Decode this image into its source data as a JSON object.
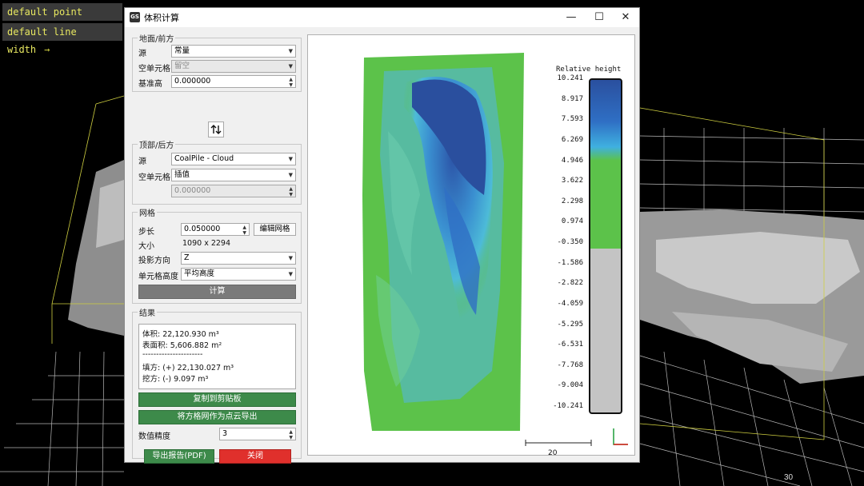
{
  "viewer": {
    "overlay_labels": [
      "default point size",
      "default line width"
    ],
    "scale_text": "30"
  },
  "window": {
    "title": "体积计算",
    "icon_text": "GS"
  },
  "ground": {
    "group_title": "地面/前方",
    "source_label": "源",
    "source_value": "常量",
    "empty_cell_label": "空单元格",
    "empty_cell_value": "留空",
    "base_height_label": "基准高",
    "base_height_value": "0.000000"
  },
  "top": {
    "group_title": "顶部/后方",
    "source_label": "源",
    "source_value": "CoalPile - Cloud",
    "empty_cell_label": "空单元格",
    "empty_cell_value": "插值",
    "value": "0.000000"
  },
  "grid": {
    "group_title": "网格",
    "step_label": "步长",
    "step_value": "0.050000",
    "edit_grid_label": "编辑网格",
    "size_label": "大小",
    "size_value": "1090 x 2294",
    "projection_label": "投影方向",
    "projection_value": "Z",
    "cell_height_label": "单元格高度",
    "cell_height_value": "平均高度",
    "compute_label": "计算"
  },
  "results": {
    "group_title": "结果",
    "volume": "体积:  22,120.930 m³",
    "surface": "表面积:  5,606.882 m²",
    "separator": "----------------------",
    "added": "填方:  (+) 22,130.027 m³",
    "removed": "挖方:  (-) 9.097 m³",
    "copy_label": "复制到剪贴板",
    "export_grid_label": "将方格网作为点云导出",
    "precision_label": "数值精度",
    "precision_value": "3",
    "export_report_label": "导出报告(PDF)",
    "close_label": "关闭"
  },
  "plot": {
    "legend_title": "Relative height",
    "colors": {
      "high": "#2a4f9e",
      "mid": "#3fb0e0",
      "low": "#5cc24a",
      "below": "#c4c4c4"
    },
    "ticks": [
      "10.241",
      "8.917",
      "7.593",
      "6.269",
      "4.946",
      "3.622",
      "2.298",
      "0.974",
      "-0.350",
      "-1.586",
      "-2.822",
      "-4.059",
      "-5.295",
      "-6.531",
      "-7.768",
      "-9.004",
      "-10.241"
    ],
    "scale_label": "20"
  }
}
